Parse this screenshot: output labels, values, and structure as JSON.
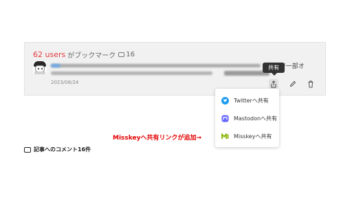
{
  "bookmark": {
    "user_count": "62 users",
    "title_suffix": "がブックマーク",
    "comment_count": "16",
    "visible_text_tail": "ns+ で一部オ",
    "date": "2023/08/24"
  },
  "actions": {
    "share_icon": "share-icon",
    "edit_icon": "pencil-icon",
    "delete_icon": "trash-icon"
  },
  "tooltip": {
    "label": "共有"
  },
  "share_menu": {
    "items": [
      {
        "label": "Twitterへ共有",
        "icon": "twitter-icon",
        "color": "#1d9bf0"
      },
      {
        "label": "Mastodonへ共有",
        "icon": "mastodon-icon",
        "color": "#6364ff"
      },
      {
        "label": "Misskeyへ共有",
        "icon": "misskey-icon",
        "color": "#86b300"
      }
    ]
  },
  "annotation": {
    "text": "Misskeyへ共有リンクが追加→",
    "color": "#e50000"
  },
  "comments": {
    "heading": "記事へのコメント16件"
  },
  "colors": {
    "accent_red": "#e4393c",
    "card_bg": "#f1f1f1"
  }
}
